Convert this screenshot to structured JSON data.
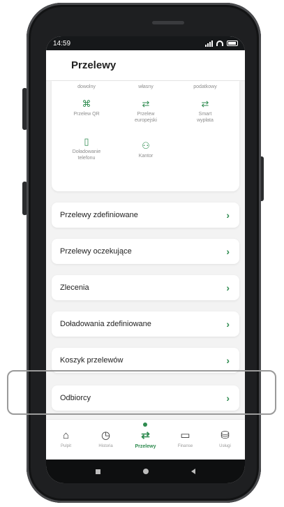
{
  "status_bar": {
    "time": "14:59"
  },
  "header": {
    "title": "Przelewy"
  },
  "transfer_grid": [
    {
      "label": "dowolny",
      "icon": "transfer-icon"
    },
    {
      "label": "własny",
      "icon": "transfer-icon"
    },
    {
      "label": "podatkowy",
      "icon": "transfer-icon"
    },
    {
      "label": "Przelew QR",
      "icon": "qr-icon"
    },
    {
      "label": "Przelew europejski",
      "icon": "transfer-arrows-icon"
    },
    {
      "label": "Smart wypłata",
      "icon": "transfer-arrows-icon"
    },
    {
      "label": "Doładowanie telefonu",
      "icon": "phone-icon"
    },
    {
      "label": "Kantor",
      "icon": "currency-exchange-icon"
    }
  ],
  "menu": [
    {
      "label": "Przelewy zdefiniowane"
    },
    {
      "label": "Przelewy oczekujące"
    },
    {
      "label": "Zlecenia"
    },
    {
      "label": "Doładowania zdefiniowane"
    },
    {
      "label": "Koszyk przelewów"
    },
    {
      "label": "Odbiorcy"
    }
  ],
  "bottom_nav": [
    {
      "label": "Pulpit",
      "icon": "home-icon",
      "active": false
    },
    {
      "label": "Historia",
      "icon": "history-icon",
      "active": false
    },
    {
      "label": "Przelewy",
      "icon": "transfer-arrows-icon",
      "active": true
    },
    {
      "label": "Finanse",
      "icon": "wallet-icon",
      "active": false
    },
    {
      "label": "Usługi",
      "icon": "database-icon",
      "active": false
    }
  ],
  "colors": {
    "accent": "#2e8b4f",
    "background": "#f3f3f3",
    "highlight_border": "#9a9a9a"
  }
}
